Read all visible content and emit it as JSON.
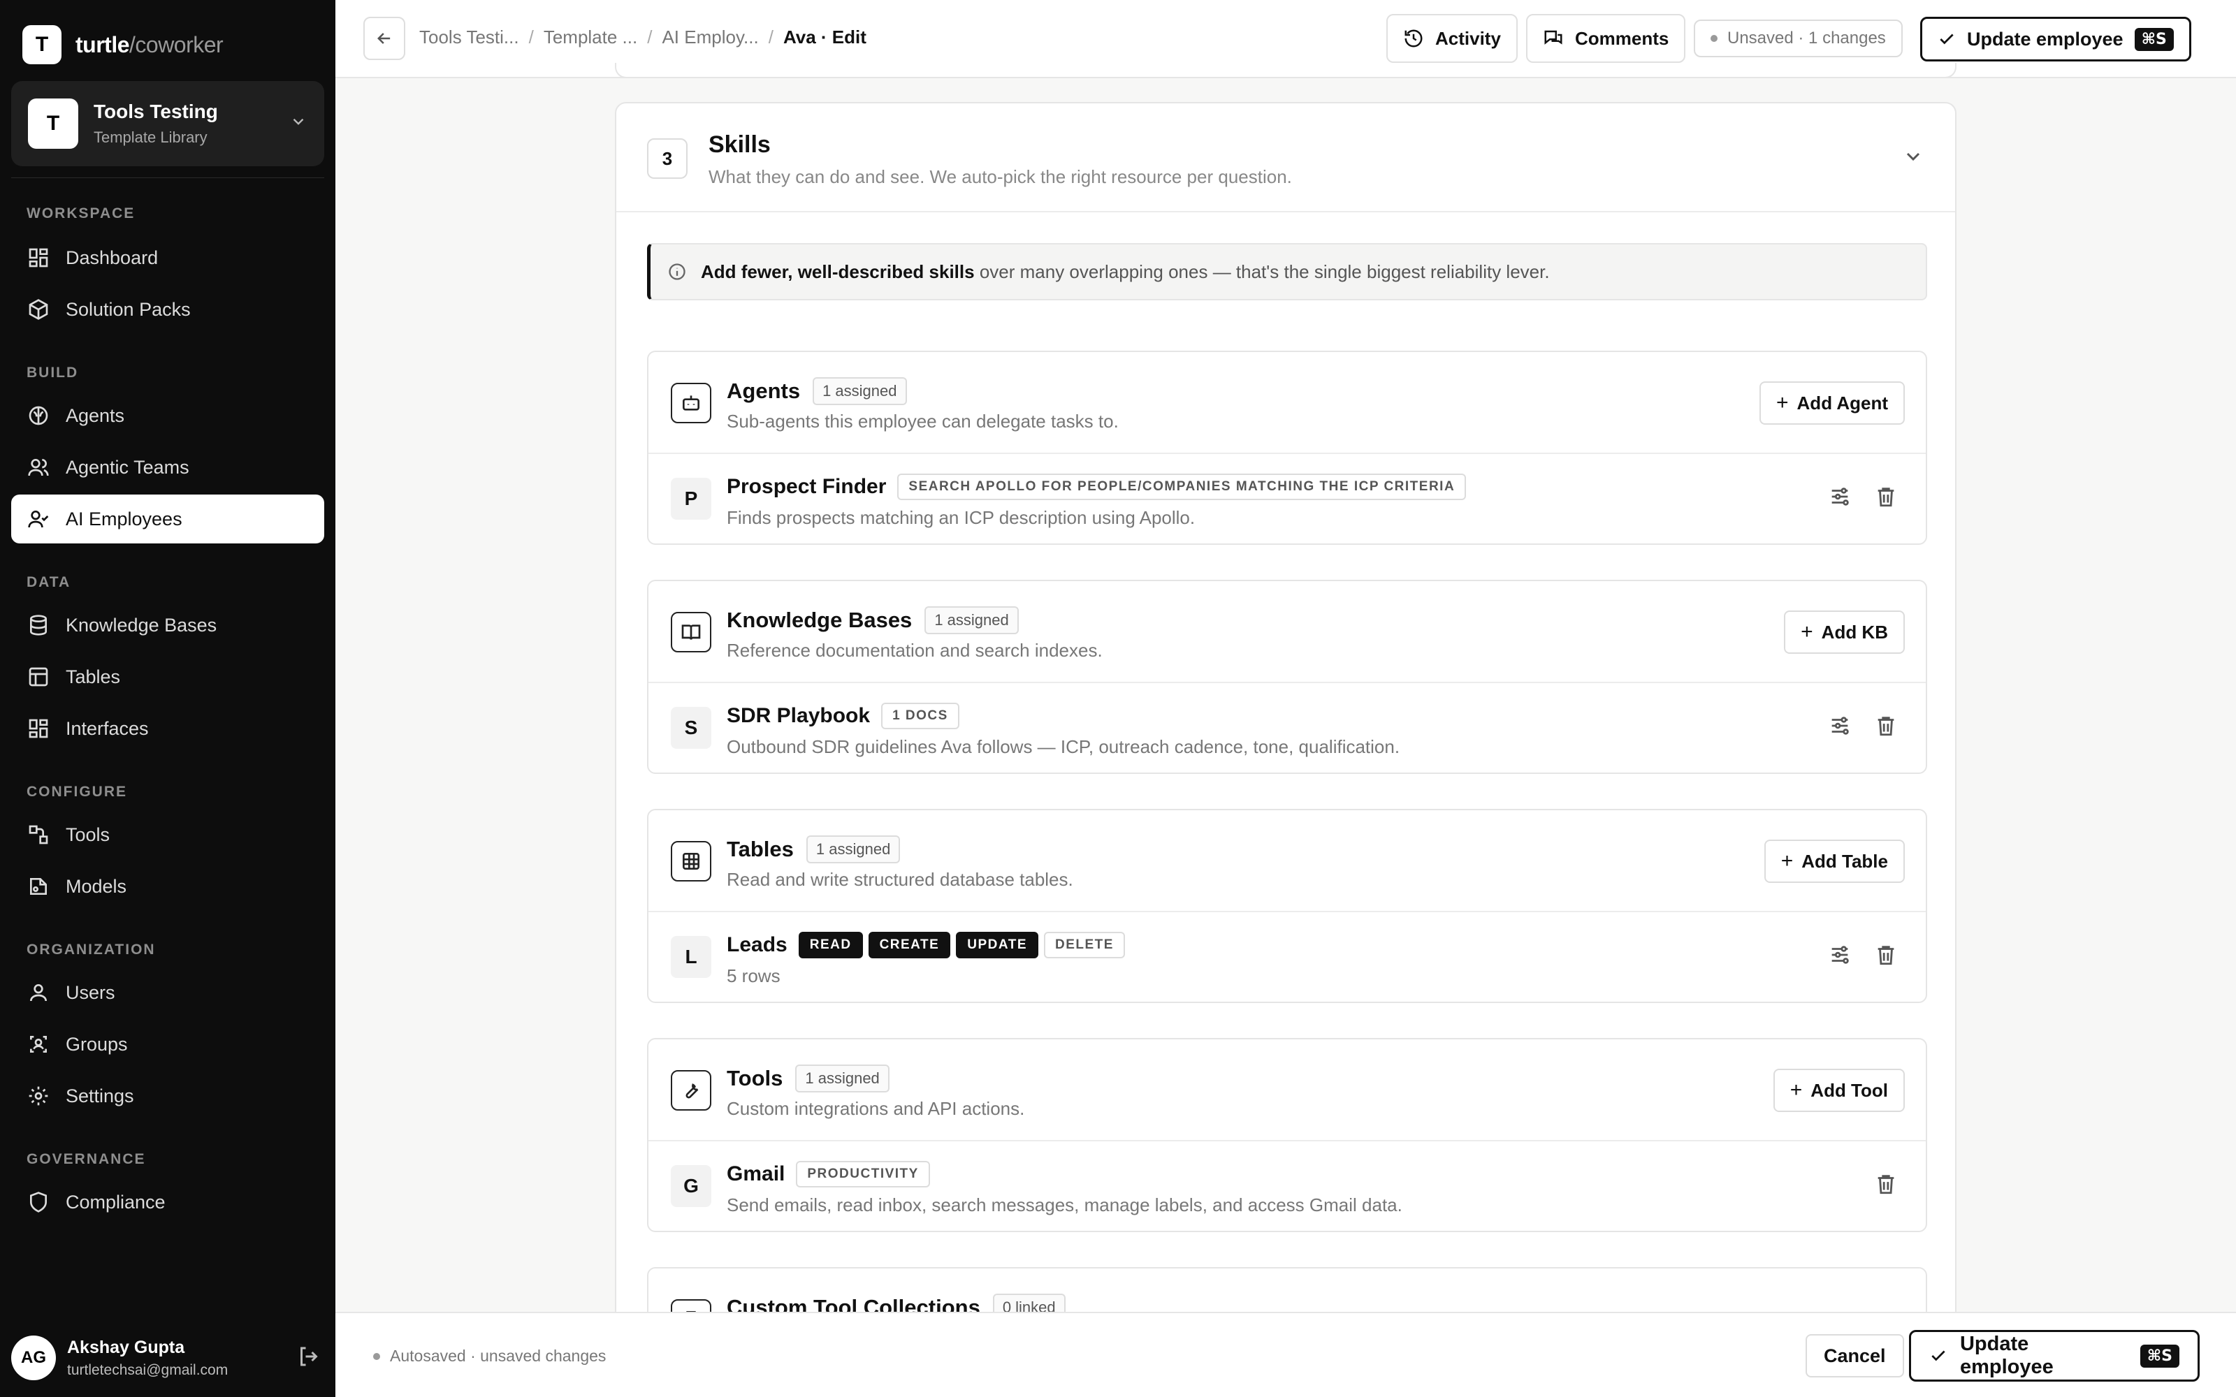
{
  "brand": {
    "logo_letter": "T",
    "name": "turtle",
    "suffix": "/coworker"
  },
  "workspace": {
    "avatar": "T",
    "title": "Tools Testing",
    "subtitle": "Template Library"
  },
  "sidebar": {
    "sections": {
      "workspace": "WORKSPACE",
      "build": "BUILD",
      "data": "DATA",
      "configure": "CONFIGURE",
      "organization": "ORGANIZATION",
      "governance": "GOVERNANCE"
    },
    "items": {
      "dashboard": "Dashboard",
      "solution_packs": "Solution Packs",
      "agents": "Agents",
      "agentic_teams": "Agentic Teams",
      "ai_employees": "AI Employees",
      "knowledge_bases": "Knowledge Bases",
      "tables": "Tables",
      "interfaces": "Interfaces",
      "tools": "Tools",
      "models": "Models",
      "users": "Users",
      "groups": "Groups",
      "settings": "Settings",
      "compliance": "Compliance"
    },
    "active": "AI Employees"
  },
  "user": {
    "initials": "AG",
    "name": "Akshay Gupta",
    "email": "turtletechsai@gmail.com"
  },
  "topbar": {
    "breadcrumbs": [
      "Tools Testi...",
      "Template ...",
      "AI Employ...",
      "Ava · Edit"
    ],
    "activity_label": "Activity",
    "comments_label": "Comments",
    "status": "Unsaved · 1 changes",
    "update_label": "Update employee",
    "shortcut": "⌘S"
  },
  "skills": {
    "step": "3",
    "title": "Skills",
    "subtitle": "What they can do and see. We auto-pick the right resource per question.",
    "tip_bold": "Add fewer, well-described skills",
    "tip_rest": "over many overlapping ones — that's the single biggest reliability lever.",
    "groups": {
      "agents": {
        "title": "Agents",
        "badge": "1 assigned",
        "subtitle": "Sub-agents this employee can delegate tasks to.",
        "add_label": "Add Agent",
        "item": {
          "letter": "P",
          "name": "Prospect Finder",
          "tag": "SEARCH APOLLO FOR PEOPLE/COMPANIES MATCHING THE ICP CRITERIA",
          "desc": "Finds prospects matching an ICP description using Apollo."
        }
      },
      "kbs": {
        "title": "Knowledge Bases",
        "badge": "1 assigned",
        "subtitle": "Reference documentation and search indexes.",
        "add_label": "Add KB",
        "item": {
          "letter": "S",
          "name": "SDR Playbook",
          "tag": "1 DOCS",
          "desc": "Outbound SDR guidelines Ava follows — ICP, outreach cadence, tone, qualification."
        }
      },
      "tables": {
        "title": "Tables",
        "badge": "1 assigned",
        "subtitle": "Read and write structured database tables.",
        "add_label": "Add Table",
        "item": {
          "letter": "L",
          "name": "Leads",
          "perms": [
            "READ",
            "CREATE",
            "UPDATE",
            "DELETE"
          ],
          "desc": "5 rows"
        }
      },
      "tools": {
        "title": "Tools",
        "badge": "1 assigned",
        "subtitle": "Custom integrations and API actions.",
        "add_label": "Add Tool",
        "item": {
          "letter": "G",
          "name": "Gmail",
          "tag": "PRODUCTIVITY",
          "desc": "Send emails, read inbox, search messages, manage labels, and access Gmail data."
        }
      },
      "collections": {
        "title": "Custom Tool Collections",
        "badge": "0 linked"
      }
    }
  },
  "footer": {
    "autosave": "Autosaved · unsaved changes",
    "cancel_label": "Cancel",
    "update_label": "Update employee",
    "shortcut": "⌘S"
  },
  "colors": {
    "sidebar_bg": "#0d0d0d",
    "accent": "#111111",
    "page_bg": "#f7f7f6"
  }
}
